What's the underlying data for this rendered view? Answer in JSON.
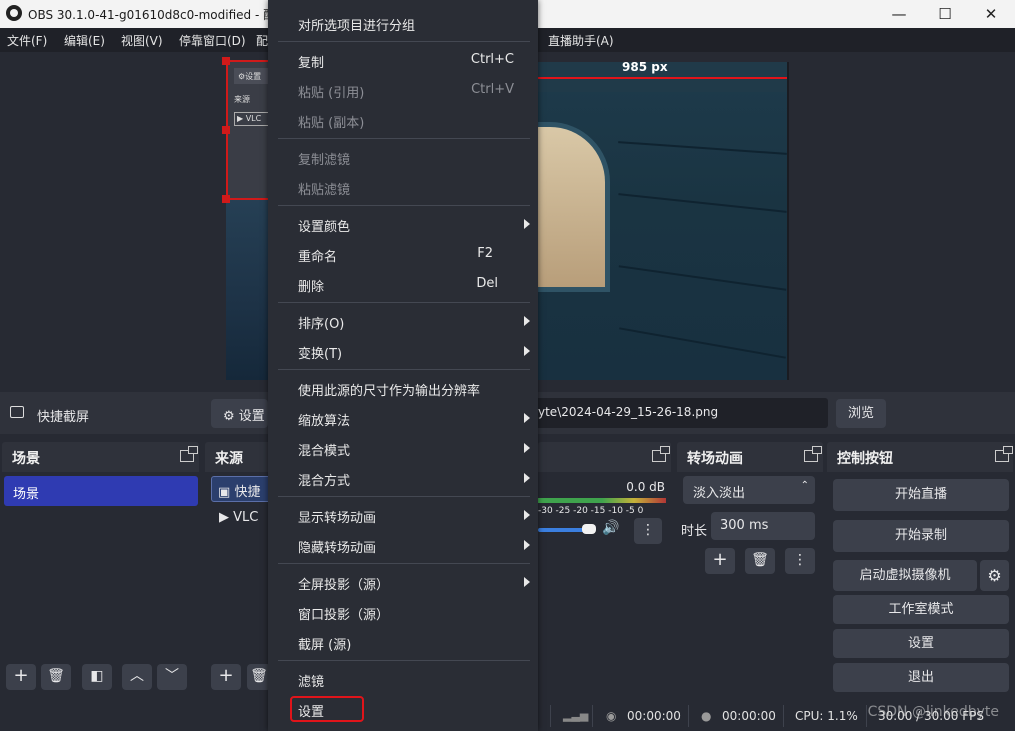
{
  "window": {
    "title": "OBS 30.1.0-41-g01610d8c0-modified - 配置文",
    "minimize": "—",
    "maximize": "☐",
    "close": "✕"
  },
  "menubar": {
    "file": "文件(F)",
    "edit": "编辑(E)",
    "view": "视图(V)",
    "dock": "停靠窗口(D)",
    "partial": "配",
    "live_assistant": "直播助手(A)"
  },
  "preview": {
    "inner_settings": "⚙设置",
    "inner_source": "来源",
    "inner_vlc": "▶ VLC",
    "ruler_label": "985 px"
  },
  "source_toolbar": {
    "source_name": "快捷截屏",
    "settings_label": "设置",
    "file_path": "yte\\2024-04-29_15-26-18.png",
    "browse_label": "浏览"
  },
  "docks": {
    "scenes": {
      "title": "场景",
      "items": [
        "场景"
      ]
    },
    "sources": {
      "title": "来源",
      "items": [
        "快捷",
        "VLC"
      ]
    },
    "mixer": {
      "db": "0.0 dB",
      "scale": "-30 -25 -20 -15 -10 -5 0"
    },
    "transitions": {
      "title": "转场动画",
      "selected": "淡入淡出",
      "duration_label": "时长",
      "duration_value": "300 ms"
    },
    "controls": {
      "title": "控制按钮",
      "start_stream": "开始直播",
      "start_record": "开始录制",
      "virtual_cam": "启动虚拟摄像机",
      "studio_mode": "工作室模式",
      "settings": "设置",
      "exit": "退出"
    }
  },
  "context_menu": {
    "group": "对所选项目进行分组",
    "copy": "复制",
    "copy_shortcut": "Ctrl+C",
    "paste_ref": "粘贴 (引用)",
    "paste_ref_shortcut": "Ctrl+V",
    "paste_dup": "粘贴 (副本)",
    "copy_filters": "复制滤镜",
    "paste_filters": "粘贴滤镜",
    "set_color": "设置颜色",
    "rename": "重命名",
    "rename_shortcut": "F2",
    "delete": "删除",
    "delete_shortcut": "Del",
    "order": "排序(O)",
    "transform": "变换(T)",
    "resize_output": "使用此源的尺寸作为输出分辨率",
    "scale_filter": "缩放算法",
    "blend_mode": "混合模式",
    "blend_method": "混合方式",
    "show_transition": "显示转场动画",
    "hide_transition": "隐藏转场动画",
    "fullscreen_projector": "全屏投影（源）",
    "windowed_projector": "窗口投影（源）",
    "screenshot": "截屏 (源)",
    "filters": "滤镜",
    "properties": "设置"
  },
  "statusbar": {
    "stream_time": "00:00:00",
    "record_time": "00:00:00",
    "cpu": "CPU: 1.1%",
    "fps": "30.00 / 30.00 FPS"
  },
  "watermark": "CSDN @linkedbyte"
}
